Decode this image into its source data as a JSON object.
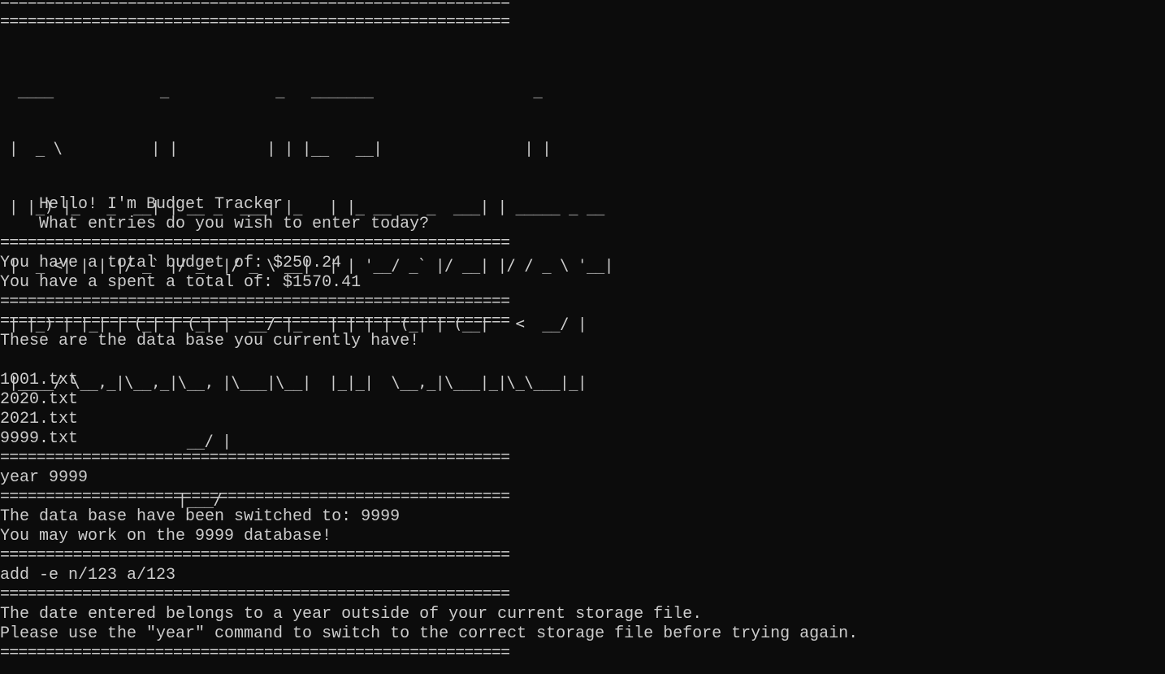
{
  "separator": "========================================================",
  "banner_lines": [
    "  ____            _            _   _______                  _",
    " |  _ \\          | |          | | |__   __|                | |",
    " | |_) |_   _  __| | __ _  ___| |_   | |_ __ __ _  ___| | _____ _ __",
    " |  _ <| | | |/ _` |/ _` |/ _ \\ __|  | | '__/ _` |/ __| |/ / _ \\ '__|",
    " | |_) | |_| | (_| | (_| |  __/ |_   | | | | (_| | (__|   <  __/ |",
    " |____/ \\__,_|\\__,_|\\__, |\\___|\\__|  |_|_|  \\__,_|\\___|_|\\_\\___|_|",
    "                     __/ |",
    "                    |___/"
  ],
  "greeting": {
    "line1": "Hello! I'm Budget Tracker",
    "line2": "What entries do you wish to enter today?"
  },
  "summary": {
    "budget": "You have a total budget of: $250.24",
    "spent": "You have a spent a total of: $1570.41"
  },
  "databases": {
    "heading": "These are the data base you currently have!",
    "files": [
      "1001.txt",
      "2020.txt",
      "2021.txt",
      "9999.txt"
    ]
  },
  "cmd1": {
    "input": "year 9999",
    "out1": "The data base have been switched to: 9999",
    "out2": "You may work on the 9999 database!"
  },
  "cmd2": {
    "input": "add -e n/123 a/123",
    "out1": "The date entered belongs to a year outside of your current storage file.",
    "out2": "Please use the \"year\" command to switch to the correct storage file before trying again."
  }
}
